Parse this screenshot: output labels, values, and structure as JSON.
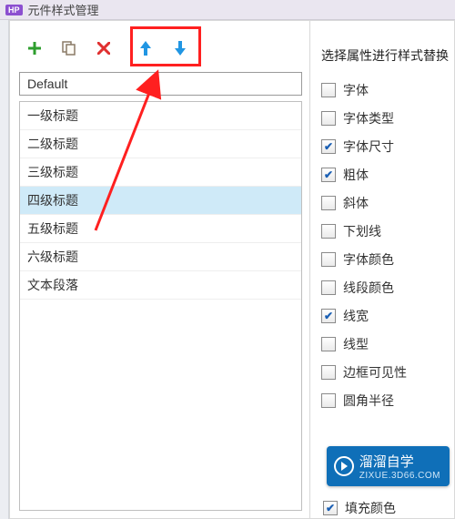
{
  "titlebar": {
    "badge": "HP",
    "title": "元件样式管理"
  },
  "left": {
    "default_label": "Default",
    "styles": [
      {
        "label": "一级标题",
        "selected": false
      },
      {
        "label": "二级标题",
        "selected": false
      },
      {
        "label": "三级标题",
        "selected": false
      },
      {
        "label": "四级标题",
        "selected": true
      },
      {
        "label": "五级标题",
        "selected": false
      },
      {
        "label": "六级标题",
        "selected": false
      },
      {
        "label": "文本段落",
        "selected": false
      }
    ]
  },
  "right": {
    "title": "选择属性进行样式替换",
    "attributes": [
      {
        "label": "字体",
        "checked": false
      },
      {
        "label": "字体类型",
        "checked": false
      },
      {
        "label": "字体尺寸",
        "checked": true
      },
      {
        "label": "粗体",
        "checked": true
      },
      {
        "label": "斜体",
        "checked": false
      },
      {
        "label": "下划线",
        "checked": false
      },
      {
        "label": "字体颜色",
        "checked": false
      },
      {
        "label": "线段颜色",
        "checked": false
      },
      {
        "label": "线宽",
        "checked": true
      },
      {
        "label": "线型",
        "checked": false
      },
      {
        "label": "边框可见性",
        "checked": false
      },
      {
        "label": "圆角半径",
        "checked": false
      }
    ],
    "cropped_attribute": {
      "label": "填充颜色",
      "checked": true
    }
  },
  "watermark": {
    "brand": "溜溜自学",
    "url": "ZIXUE.3D66.COM"
  },
  "annotations": {
    "highlight": "move-buttons-highlight",
    "arrow": "pointer-arrow"
  }
}
